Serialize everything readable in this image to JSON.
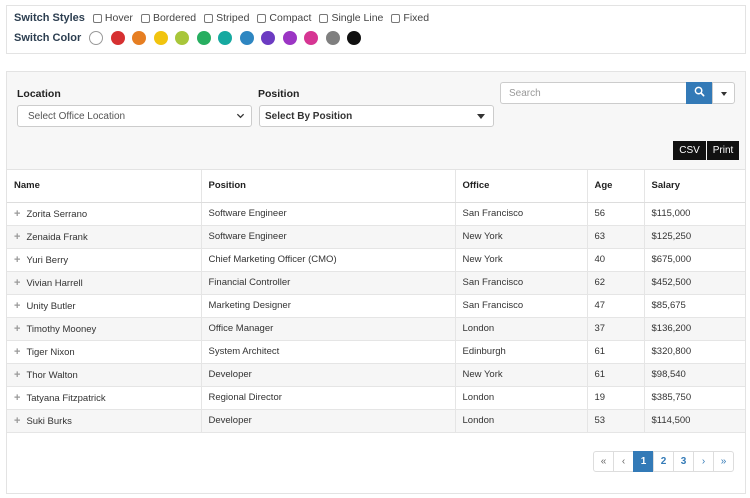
{
  "switch_styles": {
    "label": "Switch Styles",
    "options": [
      "Hover",
      "Bordered",
      "Striped",
      "Compact",
      "Single Line",
      "Fixed"
    ]
  },
  "switch_color": {
    "label": "Switch Color",
    "colors": [
      "#ffffff",
      "#d63031",
      "#e67e22",
      "#f1c40f",
      "#a8c63a",
      "#27ae60",
      "#16a9a0",
      "#2e86c1",
      "#6c3bc2",
      "#9b35c4",
      "#d63593",
      "#7f7f7f",
      "#111111"
    ]
  },
  "filters": {
    "location_label": "Location",
    "location_placeholder": "Select Office Location",
    "position_label": "Position",
    "position_placeholder": "Select By Position"
  },
  "search": {
    "placeholder": "Search"
  },
  "export": {
    "csv": "CSV",
    "print": "Print"
  },
  "table": {
    "headers": [
      "Name",
      "Position",
      "Office",
      "Age",
      "Salary"
    ],
    "rows": [
      [
        "Zorita Serrano",
        "Software Engineer",
        "San Francisco",
        "56",
        "$115,000"
      ],
      [
        "Zenaida Frank",
        "Software Engineer",
        "New York",
        "63",
        "$125,250"
      ],
      [
        "Yuri Berry",
        "Chief Marketing Officer (CMO)",
        "New York",
        "40",
        "$675,000"
      ],
      [
        "Vivian Harrell",
        "Financial Controller",
        "San Francisco",
        "62",
        "$452,500"
      ],
      [
        "Unity Butler",
        "Marketing Designer",
        "San Francisco",
        "47",
        "$85,675"
      ],
      [
        "Timothy Mooney",
        "Office Manager",
        "London",
        "37",
        "$136,200"
      ],
      [
        "Tiger Nixon",
        "System Architect",
        "Edinburgh",
        "61",
        "$320,800"
      ],
      [
        "Thor Walton",
        "Developer",
        "New York",
        "61",
        "$98,540"
      ],
      [
        "Tatyana Fitzpatrick",
        "Regional Director",
        "London",
        "19",
        "$385,750"
      ],
      [
        "Suki Burks",
        "Developer",
        "London",
        "53",
        "$114,500"
      ]
    ]
  },
  "pagination": {
    "first": "«",
    "prev": "‹",
    "pages": [
      "1",
      "2",
      "3"
    ],
    "next": "›",
    "last": "»",
    "active": "1"
  }
}
